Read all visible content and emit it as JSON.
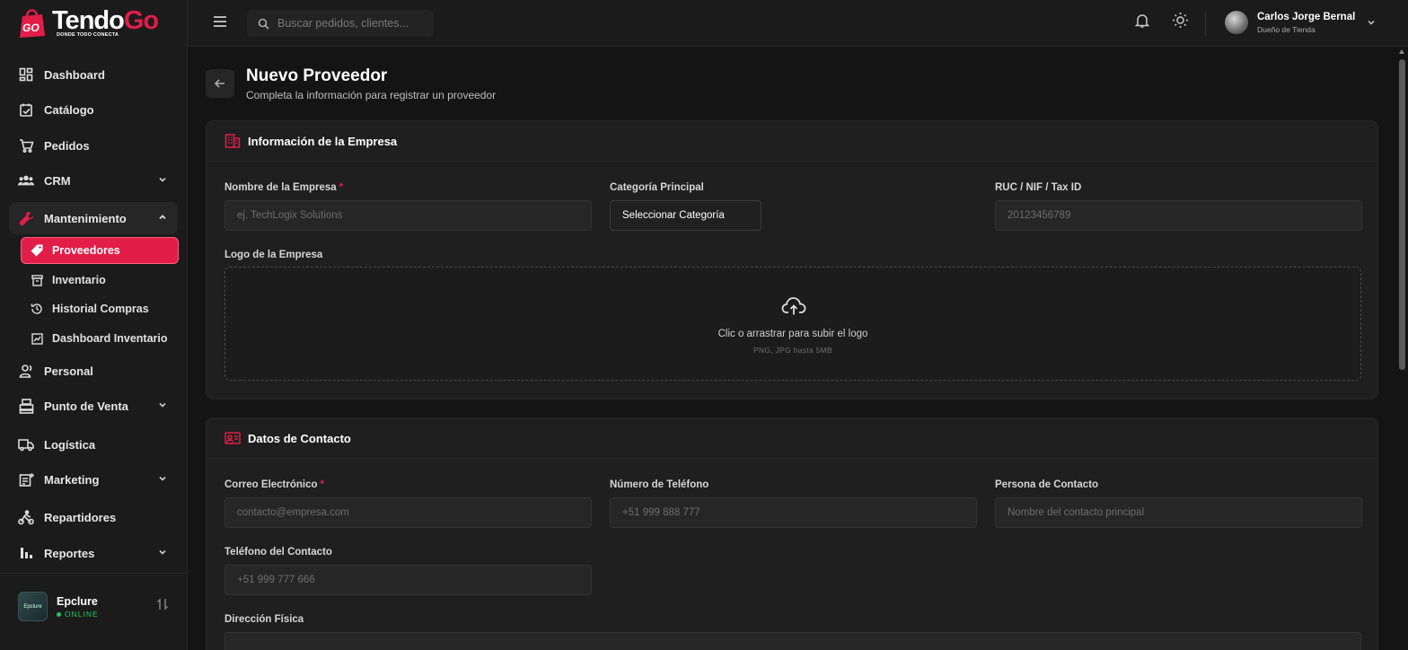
{
  "brand": {
    "name_part1": "Tendo",
    "name_part2": "Go",
    "badge": "GO",
    "tagline": "DONDE TODO CONECTA",
    "accent": "#e11d48"
  },
  "sidebar": {
    "items": [
      {
        "label": "Dashboard",
        "icon": "dashboard-icon"
      },
      {
        "label": "Catálogo",
        "icon": "catalog-icon"
      },
      {
        "label": "Pedidos",
        "icon": "cart-icon"
      },
      {
        "label": "CRM",
        "icon": "users-icon",
        "has_submenu": true
      },
      {
        "label": "Mantenimiento",
        "icon": "wrench-icon",
        "expanded": true
      },
      {
        "label": "Personal",
        "icon": "person-icon"
      },
      {
        "label": "Punto de Venta",
        "icon": "pos-icon",
        "has_submenu": true
      },
      {
        "label": "Logística",
        "icon": "truck-icon"
      },
      {
        "label": "Marketing",
        "icon": "marketing-icon",
        "has_submenu": true
      },
      {
        "label": "Repartidores",
        "icon": "bike-icon"
      },
      {
        "label": "Reportes",
        "icon": "bar-chart-icon",
        "has_submenu": true
      }
    ],
    "submenu": [
      {
        "label": "Proveedores",
        "icon": "tag-icon",
        "active": true
      },
      {
        "label": "Inventario",
        "icon": "archive-icon"
      },
      {
        "label": "Historial Compras",
        "icon": "history-icon"
      },
      {
        "label": "Dashboard Inventario",
        "icon": "chart-icon"
      }
    ],
    "store": {
      "name": "Epclure",
      "status": "ONLINE",
      "avatar_text": "Epclure"
    }
  },
  "header": {
    "search_placeholder": "Buscar pedidos, clientes...",
    "user": {
      "name": "Carlos Jorge Bernal",
      "role": "Dueño de Tienda"
    }
  },
  "page": {
    "title": "Nuevo Proveedor",
    "subtitle": "Completa la información para registrar un proveedor"
  },
  "company_section": {
    "title": "Información de la Empresa",
    "fields": {
      "name": {
        "label": "Nombre de la Empresa",
        "required_mark": "*",
        "placeholder": "ej. TechLogix Solutions"
      },
      "category": {
        "label": "Categoría Principal",
        "value": "Seleccionar Categoría"
      },
      "tax_id": {
        "label": "RUC / NIF / Tax ID",
        "placeholder": "20123456789"
      },
      "logo": {
        "label": "Logo de la Empresa",
        "upload_text": "Clic o arrastrar para subir el logo",
        "upload_hint": "PNG, JPG hasta 5MB"
      }
    }
  },
  "contact_section": {
    "title": "Datos de Contacto",
    "fields": {
      "email": {
        "label": "Correo Electrónico",
        "required_mark": "*",
        "placeholder": "contacto@empresa.com"
      },
      "phone": {
        "label": "Número de Teléfono",
        "placeholder": "+51 999 888 777"
      },
      "contact_person": {
        "label": "Persona de Contacto",
        "placeholder": "Nombre del contacto principal"
      },
      "contact_phone": {
        "label": "Teléfono del Contacto",
        "placeholder": "+51 999 777 666"
      },
      "address": {
        "label": "Dirección Física"
      }
    }
  }
}
